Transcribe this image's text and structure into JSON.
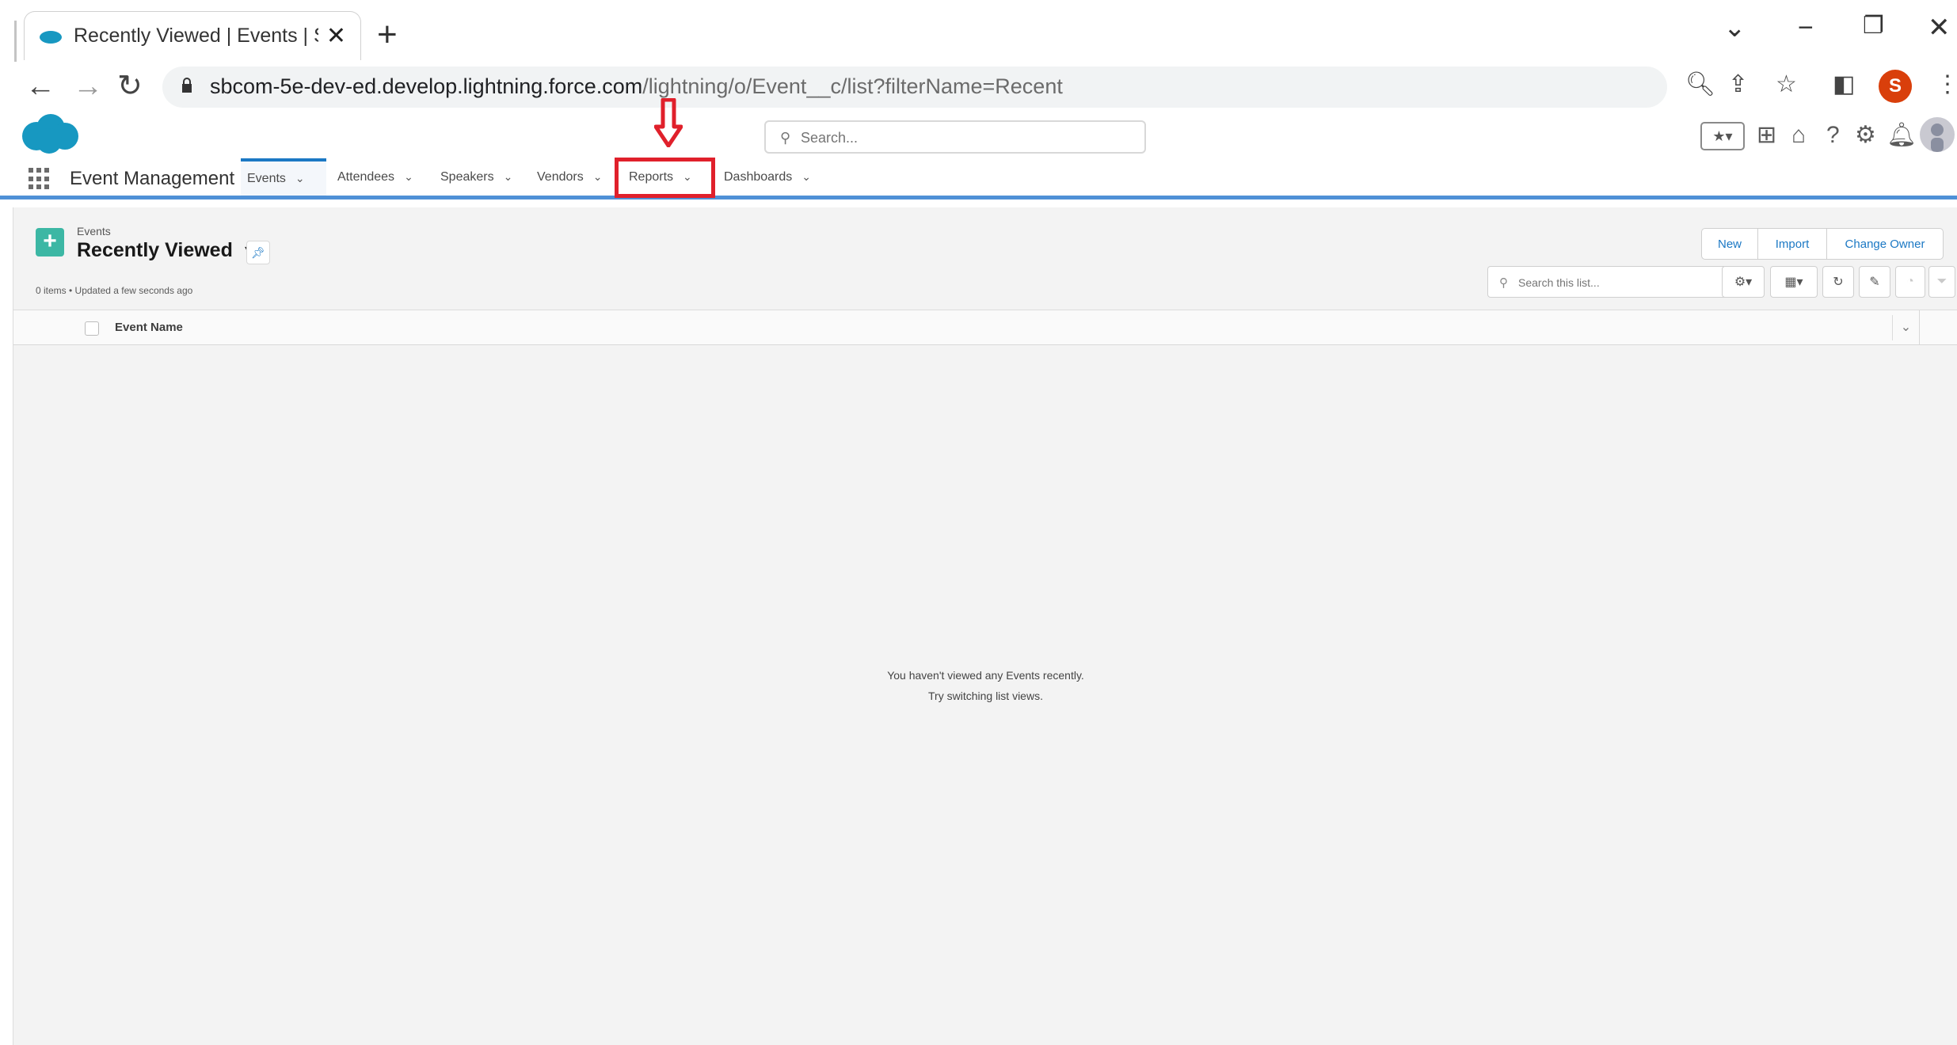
{
  "browser": {
    "tab_title": "Recently Viewed | Events | Salesf",
    "new_tab": "+",
    "url_main": "sbcom-5e-dev-ed.develop.lightning.force.com",
    "url_path": "/lightning/o/Event__c/list?filterName=Recent",
    "profile_letter": "S"
  },
  "header": {
    "search_placeholder": "Search..."
  },
  "nav": {
    "app_name": "Event Management",
    "tabs": [
      {
        "label": "Events",
        "active": true
      },
      {
        "label": "Attendees"
      },
      {
        "label": "Speakers"
      },
      {
        "label": "Vendors"
      },
      {
        "label": "Reports",
        "highlighted": true
      },
      {
        "label": "Dashboards"
      }
    ]
  },
  "list_view": {
    "object_label": "Events",
    "view_name": "Recently Viewed",
    "meta": "0 items • Updated a few seconds ago",
    "buttons": [
      "New",
      "Import",
      "Change Owner"
    ],
    "search_placeholder": "Search this list...",
    "column_header": "Event Name",
    "empty_line1": "You haven't viewed any Events recently.",
    "empty_line2": "Try switching list views."
  },
  "colors": {
    "accent": "#1b78c4",
    "annotation": "#e0202b",
    "object_icon": "#3cb7a4"
  }
}
